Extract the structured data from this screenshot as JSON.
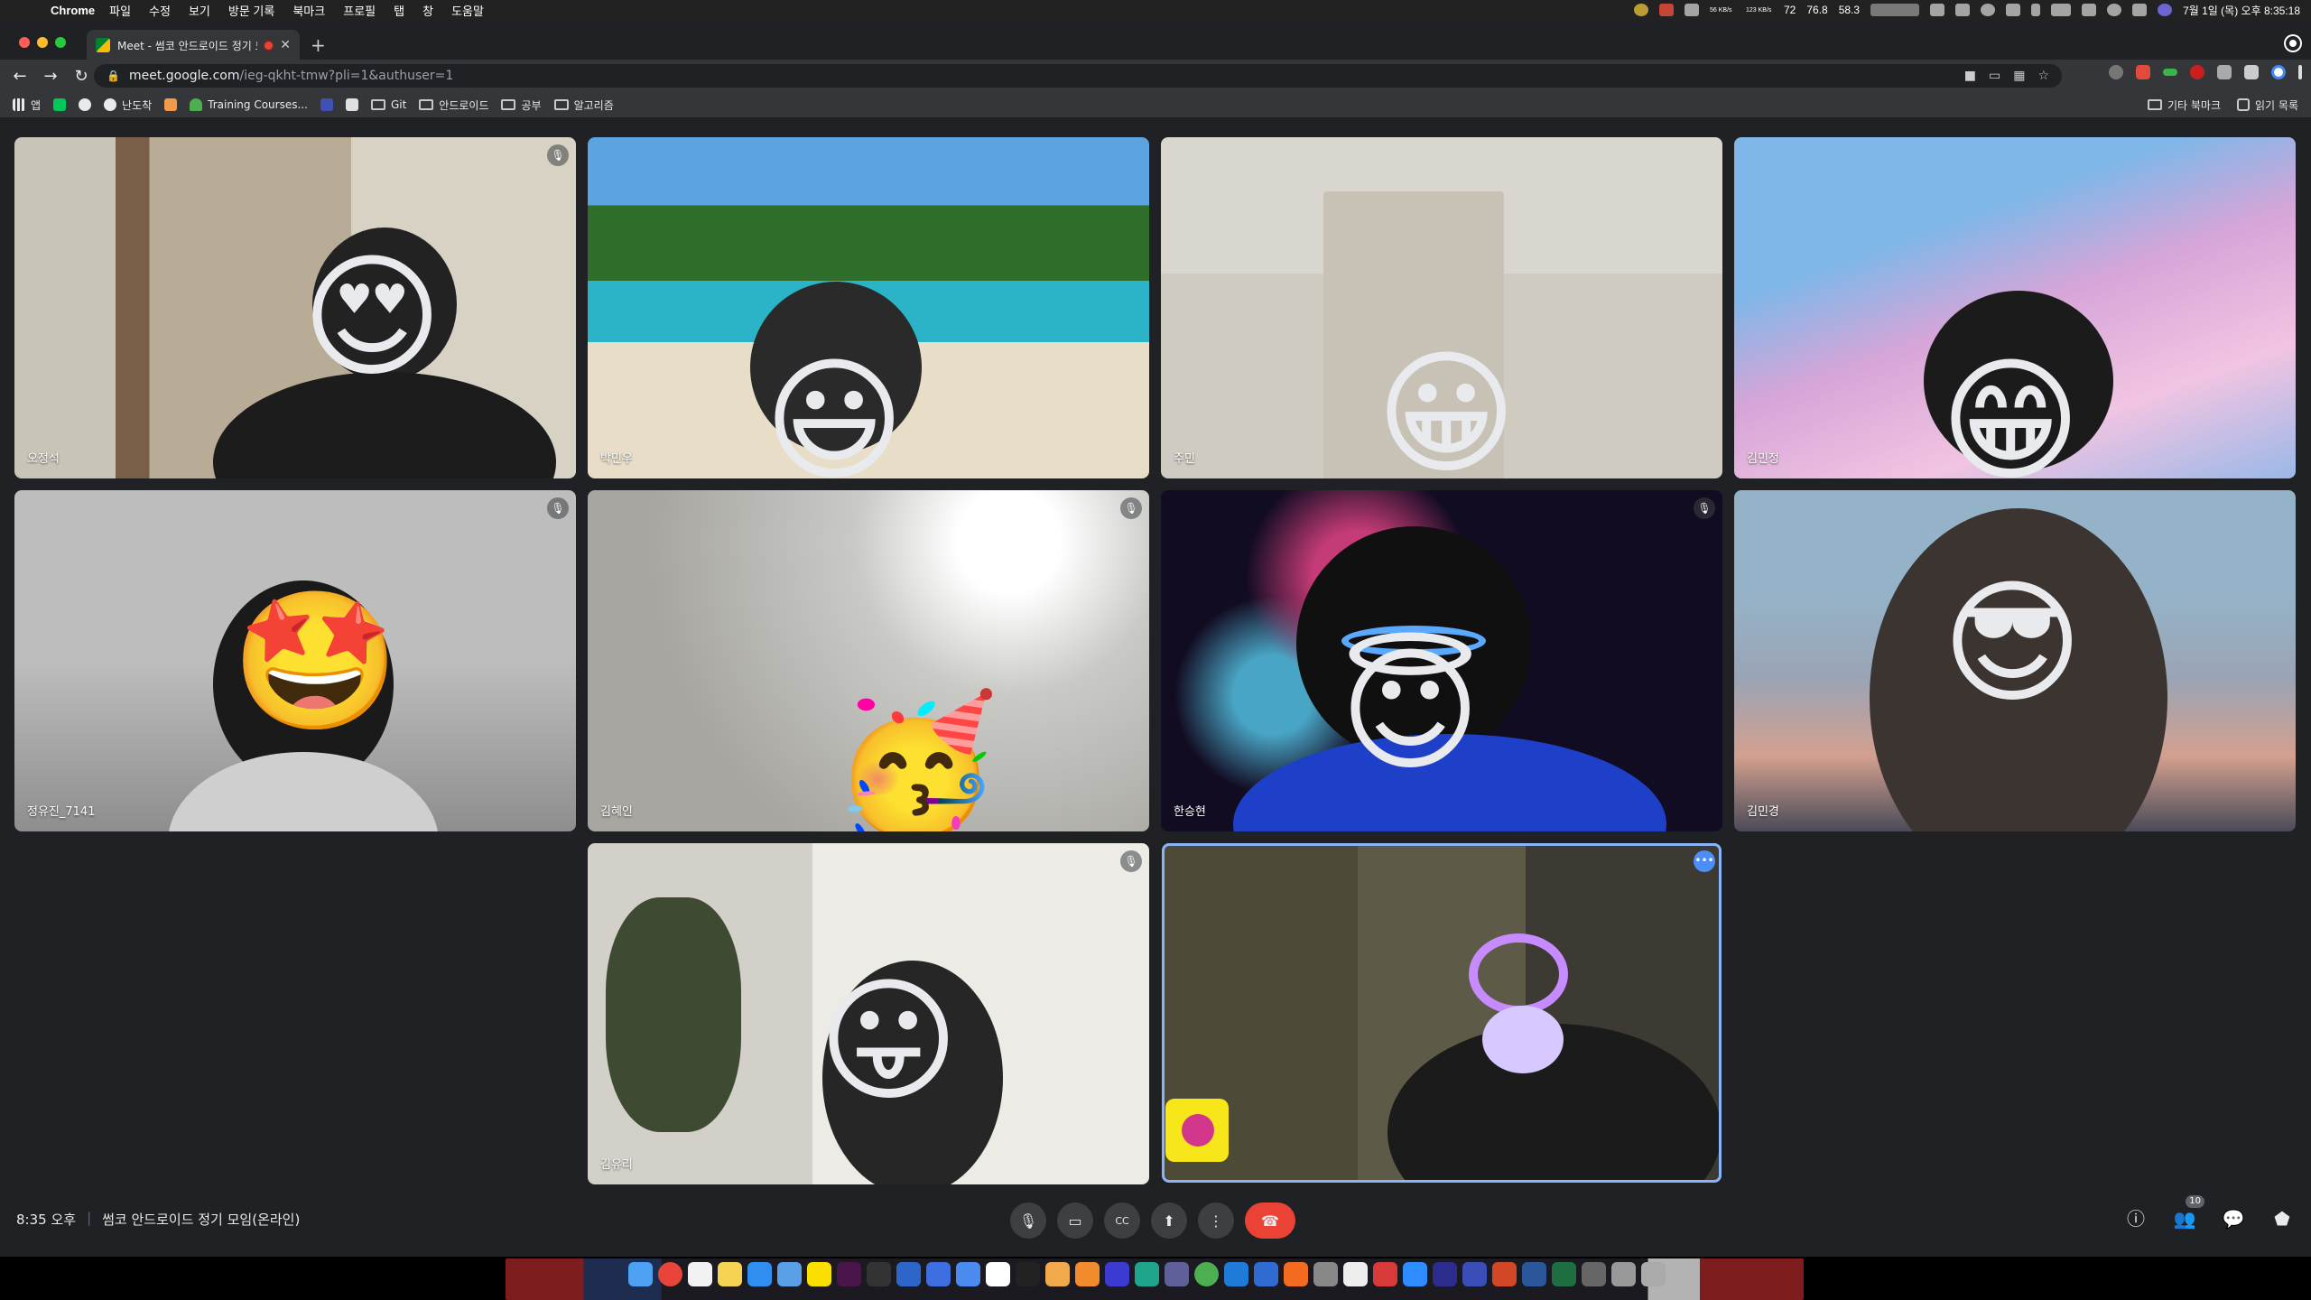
{
  "menubar": {
    "app": "Chrome",
    "menus": [
      "파일",
      "수정",
      "보기",
      "방문 기록",
      "북마크",
      "프로필",
      "탭",
      "창",
      "도움말"
    ],
    "status_net_up": "56 KB/s",
    "status_net_down": "123 KB/s",
    "status_temp": "72",
    "status_cpu": "76.8",
    "status_mem": "58.3",
    "datetime": "7월 1일 (목) 오후 8:35:18"
  },
  "browser": {
    "tab_title": "Meet - 썸코 안드로이드 정기 모",
    "url_host": "meet.google.com",
    "url_path": "/ieg-qkht-tmw?pli=1&authuser=1",
    "bookmarks": [
      "앱",
      "난도착",
      "Training Courses...",
      "Git",
      "안드로이드",
      "공부",
      "알고리즘"
    ],
    "bookmarks_right": [
      "기타 북마크",
      "읽기 목록"
    ]
  },
  "tiles": [
    {
      "name": "오정석",
      "muted": true,
      "face": "😍"
    },
    {
      "name": "박민우",
      "muted": false,
      "face": "😃"
    },
    {
      "name": "주민",
      "muted": false,
      "face": "😀"
    },
    {
      "name": "김민정",
      "muted": false,
      "face": "😁"
    },
    {
      "name": "정유진_7141",
      "muted": true,
      "face": "🤩"
    },
    {
      "name": "김혜인",
      "muted": true,
      "face": "🥳"
    },
    {
      "name": "한승현",
      "muted": true,
      "face": "😇"
    },
    {
      "name": "김민경",
      "muted": false,
      "face": "😎"
    },
    {
      "name": "김유리",
      "muted": true,
      "face": "😛"
    }
  ],
  "meeting": {
    "time": "8:35 오후",
    "separator": "|",
    "title": "썸코 안드로이드 정기 모임(온라인)",
    "participants": "10"
  },
  "icons": {
    "mute": "microphone-off-icon",
    "self_menu": "more-options-icon",
    "controls": [
      "microphone-icon",
      "camera-icon",
      "captions-icon",
      "present-icon",
      "more-icon",
      "end-call-icon"
    ],
    "right_controls": [
      "info-icon",
      "people-icon",
      "chat-icon",
      "activities-icon"
    ]
  },
  "colors": {
    "stage": "#202124",
    "end_call": "#ea4335",
    "self_border": "#8ab4f8"
  }
}
